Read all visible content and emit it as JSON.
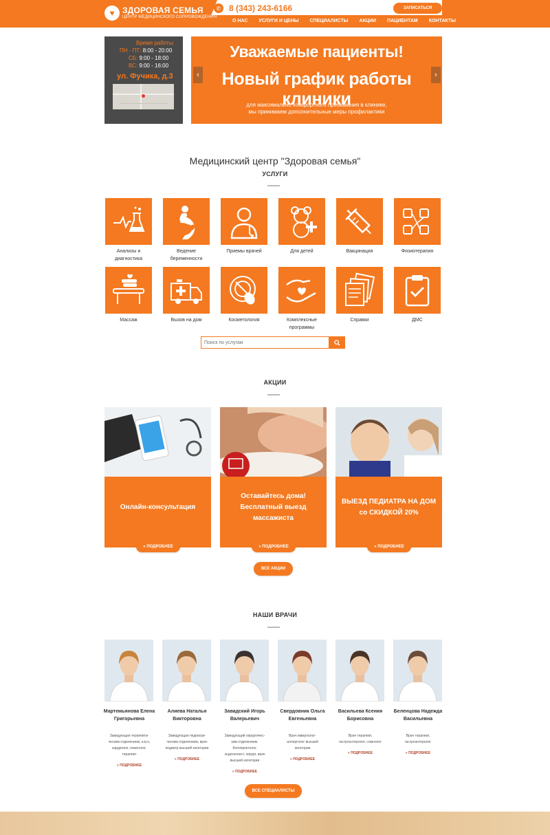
{
  "header": {
    "logo_title": "ЗДОРОВАЯ СЕМЬЯ",
    "logo_subtitle": "ЦЕНТР МЕДИЦИНСКОГО СОПРОВОЖДЕНИЯ",
    "phone": "8 (343) 243-6166",
    "signup_label": "ЗАПИСАТЬСЯ",
    "nav": [
      "О НАС",
      "УСЛУГИ И ЦЕНЫ",
      "СПЕЦИАЛИСТЫ",
      "АКЦИИ",
      "ПАЦИЕНТАМ",
      "КОНТАКТЫ"
    ]
  },
  "hours": {
    "title": "Время работы:",
    "rows": [
      {
        "day": "ПН - ПТ:",
        "time": "8:00 - 20:00"
      },
      {
        "day": "СБ:",
        "time": "9:00 - 18:00"
      },
      {
        "day": "ВС:",
        "time": "9:00 - 16:00"
      }
    ],
    "address": "ул. Фучика, д.3"
  },
  "banner": {
    "line1": "Уважаемые пациенты!",
    "line2": "Новый график работы клиники",
    "line3": "для максимально комфортного пребывания в клинике,",
    "line4": "мы принимаем дополнительные меры профилактики"
  },
  "services": {
    "main_title": "Медицинский центр \"Здоровая семья\"",
    "title": "УСЛУГИ",
    "items": [
      {
        "label1": "Анализы и",
        "label2": "диагностика",
        "icon": "lab-icon"
      },
      {
        "label1": "Ведение",
        "label2": "беременности",
        "icon": "pregnancy-icon"
      },
      {
        "label1": "Приемы врачей",
        "label2": "",
        "icon": "doctor-icon"
      },
      {
        "label1": "Для детей",
        "label2": "",
        "icon": "teddy-bear-icon"
      },
      {
        "label1": "Вакцинация",
        "label2": "",
        "icon": "syringe-icon"
      },
      {
        "label1": "Физиотерапия",
        "label2": "",
        "icon": "electrodes-icon"
      },
      {
        "label1": "Массаж",
        "label2": "",
        "icon": "massage-table-icon"
      },
      {
        "label1": "Вызов на дом",
        "label2": "",
        "icon": "ambulance-icon"
      },
      {
        "label1": "Косметология",
        "label2": "",
        "icon": "cosmetology-icon"
      },
      {
        "label1": "Комплексные",
        "label2": "программы",
        "icon": "care-hands-icon"
      },
      {
        "label1": "Справки",
        "label2": "",
        "icon": "documents-icon"
      },
      {
        "label1": "ДМС",
        "label2": "",
        "icon": "clipboard-icon"
      }
    ],
    "search_placeholder": "Поиск по услугам"
  },
  "promos": {
    "title": "АКЦИИ",
    "items": [
      {
        "line1": "Онлайн-консультация",
        "line2": "",
        "line3": "",
        "more": "» ПОДРОБНЕЕ"
      },
      {
        "line1": "Оставайтесь дома!",
        "line2": "Бесплатный выезд",
        "line3": "массажиста",
        "more": "» ПОДРОБНЕЕ"
      },
      {
        "line1": "ВЫЕЗД ПЕДИАТРА НА ДОМ",
        "line2": "со СКИДКОЙ 20%",
        "line3": "",
        "more": "» ПОДРОБНЕЕ"
      }
    ],
    "all_label": "ВСЕ АКЦИИ"
  },
  "doctors": {
    "title": "НАШИ ВРАЧИ",
    "items": [
      {
        "name1": "Мартемьянова Елена",
        "name2": "Григорьевна",
        "d1": "Заведующая терапевти-",
        "d2": "ческим отделением, к.м.н,",
        "d3": "кардиолог, гематолог,",
        "d4": "терапевт",
        "more": "» ПОДРОБНЕЕ"
      },
      {
        "name1": "Алиева Наталья",
        "name2": "Викторовна",
        "d1": "Заведующая педиатри-",
        "d2": "ческим отделением, врач",
        "d3": "педиатр высшей категории",
        "d4": "",
        "more": "» ПОДРОБНЕЕ"
      },
      {
        "name1": "Завадский Игорь",
        "name2": "Валерьевич",
        "d1": "Заведующий хирургичес-",
        "d2": "ким отделением.",
        "d3": "Колопроктолог,",
        "d4": "эндоскопист, хирург, врач",
        "d5": "высшей категории",
        "more": "» ПОДРОБНЕЕ"
      },
      {
        "name1": "Свердовник Ольга",
        "name2": "Евгеньевна",
        "d1": "Врач иммунолог-",
        "d2": "аллерголог высшей",
        "d3": "категории",
        "d4": "",
        "more": "» ПОДРОБНЕЕ"
      },
      {
        "name1": "Васильева Ксения",
        "name2": "Борисовна",
        "d1": "Врач терапевт,",
        "d2": "гастроэнтеролог, сомнолог",
        "d3": "",
        "d4": "",
        "more": "» ПОДРОБНЕЕ"
      },
      {
        "name1": "Беленцова Надежда",
        "name2": "Васильевна",
        "d1": "Врач терапевт,",
        "d2": "гастроэнтеролог",
        "d3": "",
        "d4": "",
        "more": "» ПОДРОБНЕЕ"
      }
    ],
    "all_label": "ВСЕ СПЕЦИАЛИСТЫ"
  },
  "colors": {
    "accent": "#f47920",
    "dark_panel": "#4a4a4a"
  }
}
